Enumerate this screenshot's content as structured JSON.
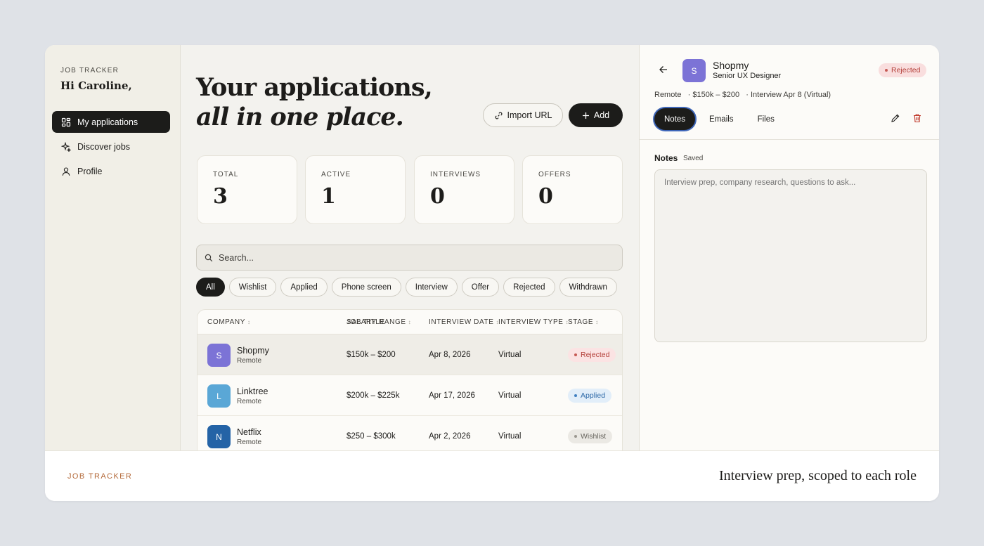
{
  "sidebar": {
    "brand": "JOB TRACKER",
    "greeting": "Hi Caroline,",
    "items": [
      {
        "label": "My applications",
        "icon": "grid-icon",
        "active": true
      },
      {
        "label": "Discover jobs",
        "icon": "sparkle-icon"
      },
      {
        "label": "Profile",
        "icon": "user-icon"
      }
    ]
  },
  "main": {
    "title_line1": "Your applications,",
    "title_line2": "all in one place.",
    "import_label": "Import URL",
    "add_label": "Add",
    "stats": [
      {
        "label": "TOTAL",
        "value": "3"
      },
      {
        "label": "ACTIVE",
        "value": "1"
      },
      {
        "label": "INTERVIEWS",
        "value": "0"
      },
      {
        "label": "OFFERS",
        "value": "0"
      }
    ],
    "search_placeholder": "Search...",
    "filters": [
      "All",
      "Wishlist",
      "Applied",
      "Phone screen",
      "Interview",
      "Offer",
      "Rejected",
      "Withdrawn"
    ],
    "active_filter": "All",
    "table": {
      "headers": {
        "company": "COMPANY",
        "job_title": "JOB TITLE",
        "salary_range": "SALARY RANGE",
        "interview_date": "INTERVIEW DATE",
        "interview_type": "INTERVIEW TYPE",
        "stage": "STAGE"
      },
      "rows": [
        {
          "logo": "S",
          "logo_color": "#7c73d6",
          "company": "Shopmy",
          "location": "Remote",
          "salary": "$150k – $200",
          "date": "Apr 8, 2026",
          "type": "Virtual",
          "stage": "Rejected",
          "stage_bg": "#fbe3e3",
          "stage_fg": "#b4403a"
        },
        {
          "logo": "L",
          "logo_color": "#5aa7d6",
          "company": "Linktree",
          "location": "Remote",
          "salary": "$200k – $225k",
          "date": "Apr 17, 2026",
          "type": "Virtual",
          "stage": "Applied",
          "stage_bg": "#e2eef9",
          "stage_fg": "#2f6aa8"
        },
        {
          "logo": "N",
          "logo_color": "#2463a6",
          "company": "Netflix",
          "location": "Remote",
          "salary": "$250 – $300k",
          "date": "Apr 2, 2026",
          "type": "Virtual",
          "stage": "Wishlist",
          "stage_bg": "#ebe9e4",
          "stage_fg": "#66635c"
        }
      ]
    }
  },
  "detail": {
    "logo": "S",
    "company": "Shopmy",
    "role": "Senior UX Designer",
    "status": "Rejected",
    "meta": "Remote   · $150k – $200   · Interview Apr 8 (Virtual)",
    "tabs": [
      "Notes",
      "Emails",
      "Files"
    ],
    "active_tab": "Notes",
    "notes_label": "Notes",
    "notes_status": "Saved",
    "notes_placeholder": "Interview prep, company research, questions to ask..."
  },
  "footer": {
    "brand": "JOB TRACKER",
    "caption": "Interview prep, scoped to each role"
  }
}
